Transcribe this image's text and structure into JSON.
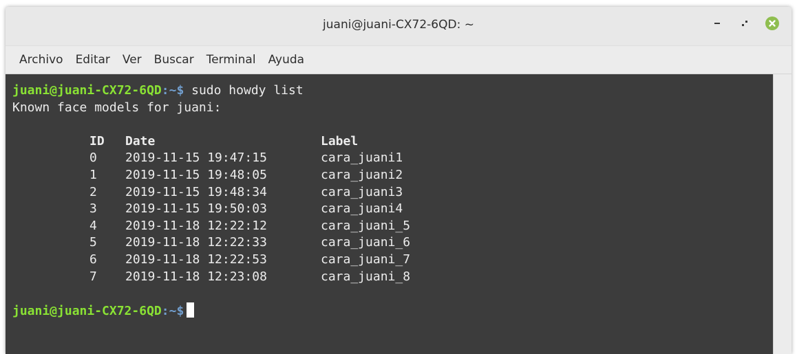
{
  "window": {
    "title": "juani@juani-CX72-6QD: ~"
  },
  "menubar": {
    "items": [
      {
        "label": "Archivo"
      },
      {
        "label": "Editar"
      },
      {
        "label": "Ver"
      },
      {
        "label": "Buscar"
      },
      {
        "label": "Terminal"
      },
      {
        "label": "Ayuda"
      }
    ]
  },
  "colors": {
    "prompt_user": "#8ae234",
    "prompt_path": "#729fcf",
    "terminal_bg": "#3c3c3c",
    "close_button": "#8fbe4f"
  },
  "terminal": {
    "prompt_user_host": "juani@juani-CX72-6QD",
    "prompt_path_part": ":~",
    "prompt_dollar": "$",
    "command": " sudo howdy list",
    "header_line": "Known face models for juani:",
    "table_headers": {
      "id": "ID",
      "date": "Date",
      "label": "Label"
    },
    "rows": [
      {
        "id": "0",
        "date": "2019-11-15 19:47:15",
        "label": "cara_juani1"
      },
      {
        "id": "1",
        "date": "2019-11-15 19:48:05",
        "label": "cara_juani2"
      },
      {
        "id": "2",
        "date": "2019-11-15 19:48:34",
        "label": "cara_juani3"
      },
      {
        "id": "3",
        "date": "2019-11-15 19:50:03",
        "label": "cara_juani4"
      },
      {
        "id": "4",
        "date": "2019-11-18 12:22:12",
        "label": "cara_juani_5"
      },
      {
        "id": "5",
        "date": "2019-11-18 12:22:33",
        "label": "cara_juani_6"
      },
      {
        "id": "6",
        "date": "2019-11-18 12:22:53",
        "label": "cara_juani_7"
      },
      {
        "id": "7",
        "date": "2019-11-18 12:23:08",
        "label": "cara_juani_8"
      }
    ],
    "final_prompt_user_host": "juani@juani-CX72-6QD",
    "final_prompt_path": ":~",
    "final_prompt_dollar": "$"
  },
  "icons": {
    "minimize": "minimize-icon",
    "maximize": "maximize-icon",
    "close": "close-icon"
  }
}
